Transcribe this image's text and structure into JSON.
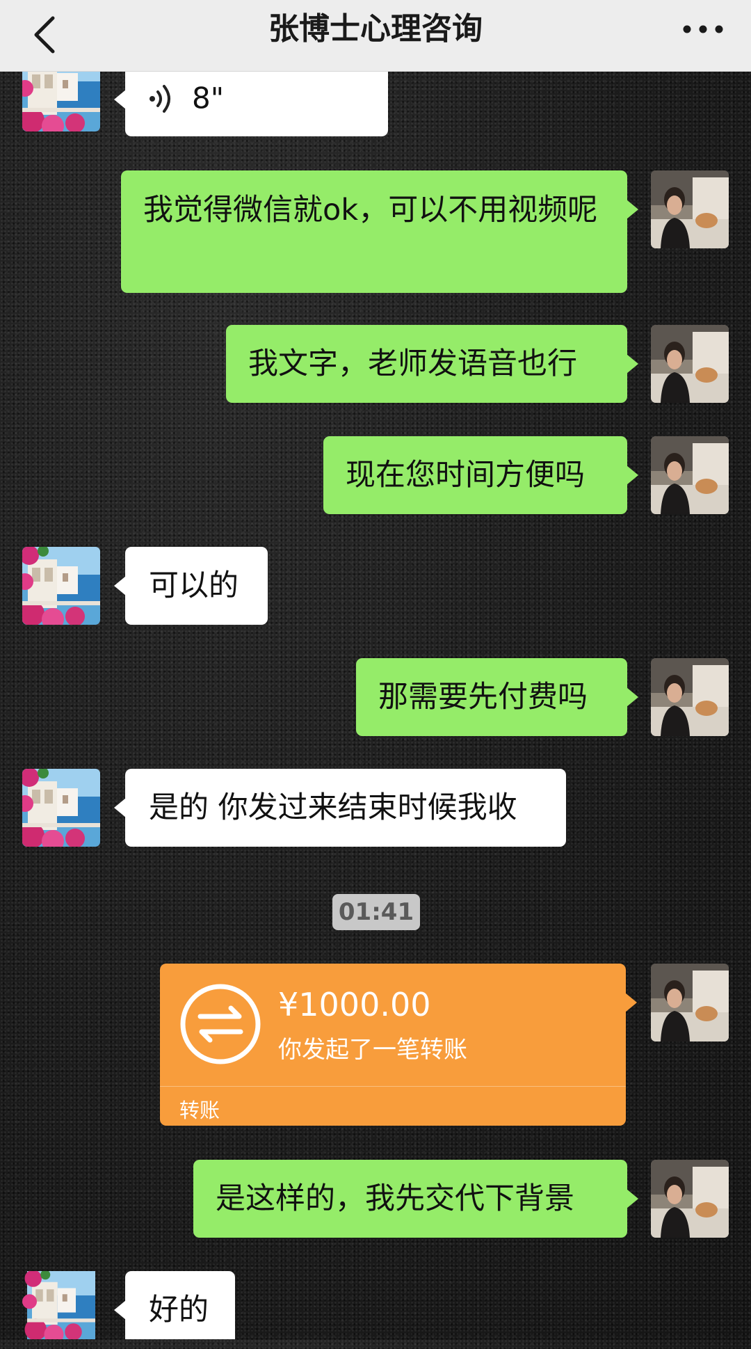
{
  "header": {
    "title": "张博士心理咨询",
    "back_icon": "chevron-left-icon",
    "more_icon": "more-dots-icon"
  },
  "colors": {
    "outgoing_bubble": "#95ec69",
    "incoming_bubble": "#ffffff",
    "transfer_card": "#f89d3c",
    "header_bg": "#ededed"
  },
  "messages": [
    {
      "side": "left",
      "type": "voice",
      "icon": "voice-wave-icon",
      "duration": "8\""
    },
    {
      "side": "right",
      "type": "text",
      "text": "我觉得微信就ok，可以不用视频呢"
    },
    {
      "side": "right",
      "type": "text",
      "text": "我文字，老师发语音也行"
    },
    {
      "side": "right",
      "type": "text",
      "text": "现在您时间方便吗"
    },
    {
      "side": "left",
      "type": "text",
      "text": "可以的"
    },
    {
      "side": "right",
      "type": "text",
      "text": "那需要先付费吗"
    },
    {
      "side": "left",
      "type": "text",
      "text": "是的 你发过来结束时候我收"
    },
    {
      "side": "right",
      "type": "text",
      "text": "是这样的，我先交代下背景"
    },
    {
      "side": "left",
      "type": "text",
      "text": "好的"
    }
  ],
  "timestamp": "01:41",
  "transfer": {
    "amount": "¥1000.00",
    "description": "你发起了一笔转账",
    "label": "转账",
    "icon": "transfer-arrows-icon"
  }
}
